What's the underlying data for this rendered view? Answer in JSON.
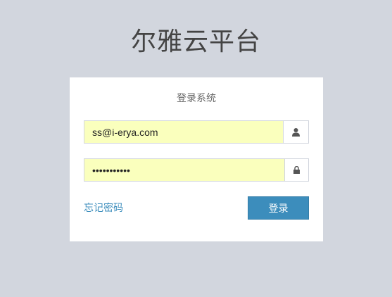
{
  "brand": {
    "title": "尔雅云平台"
  },
  "login_box": {
    "message": "登录系统",
    "email": {
      "value": "ss@i-erya.com",
      "icon": "user-icon"
    },
    "password": {
      "value": "ss123456789",
      "icon": "lock-icon"
    },
    "forgot_label": "忘记密码",
    "submit_label": "登录"
  },
  "colors": {
    "background": "#d2d6de",
    "autofill": "#faffbd",
    "accent": "#3c8dbc"
  }
}
